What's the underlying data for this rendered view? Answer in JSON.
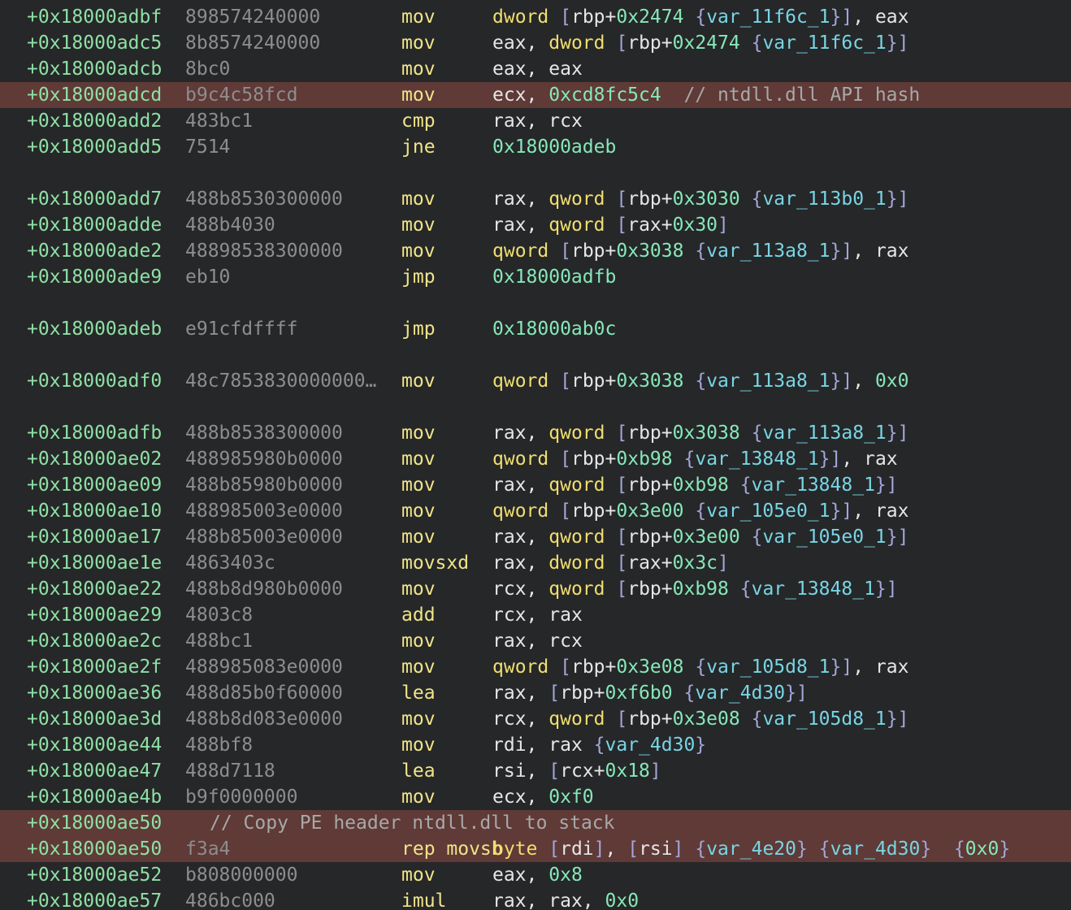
{
  "lines": [
    {
      "addr": "+0x18000adbf",
      "bytes": "898574240000",
      "mnem": "mov",
      "ops": [
        [
          "sz",
          "dword"
        ],
        [
          "pl",
          " "
        ],
        [
          "br",
          "["
        ],
        [
          "reg",
          "rbp"
        ],
        [
          "pl",
          "+"
        ],
        [
          "num",
          "0x2474"
        ],
        [
          "pl",
          " "
        ],
        [
          "br",
          "{"
        ],
        [
          "var",
          "var_11f6c_1"
        ],
        [
          "br",
          "}"
        ],
        [
          "br",
          "]"
        ],
        [
          "pl",
          ", "
        ],
        [
          "reg",
          "eax"
        ]
      ]
    },
    {
      "addr": "+0x18000adc5",
      "bytes": "8b8574240000",
      "mnem": "mov",
      "ops": [
        [
          "reg",
          "eax"
        ],
        [
          "pl",
          ", "
        ],
        [
          "sz",
          "dword"
        ],
        [
          "pl",
          " "
        ],
        [
          "br",
          "["
        ],
        [
          "reg",
          "rbp"
        ],
        [
          "pl",
          "+"
        ],
        [
          "num",
          "0x2474"
        ],
        [
          "pl",
          " "
        ],
        [
          "br",
          "{"
        ],
        [
          "var",
          "var_11f6c_1"
        ],
        [
          "br",
          "}"
        ],
        [
          "br",
          "]"
        ]
      ]
    },
    {
      "addr": "+0x18000adcb",
      "bytes": "8bc0",
      "mnem": "mov",
      "ops": [
        [
          "reg",
          "eax"
        ],
        [
          "pl",
          ", "
        ],
        [
          "reg",
          "eax"
        ]
      ]
    },
    {
      "addr": "+0x18000adcd",
      "bytes": "b9c4c58fcd",
      "mnem": "mov",
      "hl": true,
      "ops": [
        [
          "reg",
          "ecx"
        ],
        [
          "pl",
          ", "
        ],
        [
          "num",
          "0xcd8fc5c4"
        ],
        [
          "pl",
          "  "
        ],
        [
          "cmt",
          "// ntdll.dll API hash"
        ]
      ]
    },
    {
      "addr": "+0x18000add2",
      "bytes": "483bc1",
      "mnem": "cmp",
      "ops": [
        [
          "reg",
          "rax"
        ],
        [
          "pl",
          ", "
        ],
        [
          "reg",
          "rcx"
        ]
      ]
    },
    {
      "addr": "+0x18000add5",
      "bytes": "7514",
      "mnem": "jne",
      "ops": [
        [
          "num",
          "0x18000adeb"
        ]
      ]
    },
    {
      "blank": true
    },
    {
      "addr": "+0x18000add7",
      "bytes": "488b8530300000",
      "mnem": "mov",
      "ops": [
        [
          "reg",
          "rax"
        ],
        [
          "pl",
          ", "
        ],
        [
          "sz",
          "qword"
        ],
        [
          "pl",
          " "
        ],
        [
          "br",
          "["
        ],
        [
          "reg",
          "rbp"
        ],
        [
          "pl",
          "+"
        ],
        [
          "num",
          "0x3030"
        ],
        [
          "pl",
          " "
        ],
        [
          "br",
          "{"
        ],
        [
          "var",
          "var_113b0_1"
        ],
        [
          "br",
          "}"
        ],
        [
          "br",
          "]"
        ]
      ]
    },
    {
      "addr": "+0x18000adde",
      "bytes": "488b4030",
      "mnem": "mov",
      "ops": [
        [
          "reg",
          "rax"
        ],
        [
          "pl",
          ", "
        ],
        [
          "sz",
          "qword"
        ],
        [
          "pl",
          " "
        ],
        [
          "br",
          "["
        ],
        [
          "reg",
          "rax"
        ],
        [
          "pl",
          "+"
        ],
        [
          "num",
          "0x30"
        ],
        [
          "br",
          "]"
        ]
      ]
    },
    {
      "addr": "+0x18000ade2",
      "bytes": "48898538300000",
      "mnem": "mov",
      "ops": [
        [
          "sz",
          "qword"
        ],
        [
          "pl",
          " "
        ],
        [
          "br",
          "["
        ],
        [
          "reg",
          "rbp"
        ],
        [
          "pl",
          "+"
        ],
        [
          "num",
          "0x3038"
        ],
        [
          "pl",
          " "
        ],
        [
          "br",
          "{"
        ],
        [
          "var",
          "var_113a8_1"
        ],
        [
          "br",
          "}"
        ],
        [
          "br",
          "]"
        ],
        [
          "pl",
          ", "
        ],
        [
          "reg",
          "rax"
        ]
      ]
    },
    {
      "addr": "+0x18000ade9",
      "bytes": "eb10",
      "mnem": "jmp",
      "ops": [
        [
          "num",
          "0x18000adfb"
        ]
      ]
    },
    {
      "blank": true
    },
    {
      "addr": "+0x18000adeb",
      "bytes": "e91cfdffff",
      "mnem": "jmp",
      "ops": [
        [
          "num",
          "0x18000ab0c"
        ]
      ]
    },
    {
      "blank": true
    },
    {
      "addr": "+0x18000adf0",
      "bytes": "48c7853830000000…",
      "mnem": "mov",
      "ops": [
        [
          "sz",
          "qword"
        ],
        [
          "pl",
          " "
        ],
        [
          "br",
          "["
        ],
        [
          "reg",
          "rbp"
        ],
        [
          "pl",
          "+"
        ],
        [
          "num",
          "0x3038"
        ],
        [
          "pl",
          " "
        ],
        [
          "br",
          "{"
        ],
        [
          "var",
          "var_113a8_1"
        ],
        [
          "br",
          "}"
        ],
        [
          "br",
          "]"
        ],
        [
          "pl",
          ", "
        ],
        [
          "num",
          "0x0"
        ]
      ]
    },
    {
      "blank": true
    },
    {
      "addr": "+0x18000adfb",
      "bytes": "488b8538300000",
      "mnem": "mov",
      "ops": [
        [
          "reg",
          "rax"
        ],
        [
          "pl",
          ", "
        ],
        [
          "sz",
          "qword"
        ],
        [
          "pl",
          " "
        ],
        [
          "br",
          "["
        ],
        [
          "reg",
          "rbp"
        ],
        [
          "pl",
          "+"
        ],
        [
          "num",
          "0x3038"
        ],
        [
          "pl",
          " "
        ],
        [
          "br",
          "{"
        ],
        [
          "var",
          "var_113a8_1"
        ],
        [
          "br",
          "}"
        ],
        [
          "br",
          "]"
        ]
      ]
    },
    {
      "addr": "+0x18000ae02",
      "bytes": "488985980b0000",
      "mnem": "mov",
      "ops": [
        [
          "sz",
          "qword"
        ],
        [
          "pl",
          " "
        ],
        [
          "br",
          "["
        ],
        [
          "reg",
          "rbp"
        ],
        [
          "pl",
          "+"
        ],
        [
          "num",
          "0xb98"
        ],
        [
          "pl",
          " "
        ],
        [
          "br",
          "{"
        ],
        [
          "var",
          "var_13848_1"
        ],
        [
          "br",
          "}"
        ],
        [
          "br",
          "]"
        ],
        [
          "pl",
          ", "
        ],
        [
          "reg",
          "rax"
        ]
      ]
    },
    {
      "addr": "+0x18000ae09",
      "bytes": "488b85980b0000",
      "mnem": "mov",
      "ops": [
        [
          "reg",
          "rax"
        ],
        [
          "pl",
          ", "
        ],
        [
          "sz",
          "qword"
        ],
        [
          "pl",
          " "
        ],
        [
          "br",
          "["
        ],
        [
          "reg",
          "rbp"
        ],
        [
          "pl",
          "+"
        ],
        [
          "num",
          "0xb98"
        ],
        [
          "pl",
          " "
        ],
        [
          "br",
          "{"
        ],
        [
          "var",
          "var_13848_1"
        ],
        [
          "br",
          "}"
        ],
        [
          "br",
          "]"
        ]
      ]
    },
    {
      "addr": "+0x18000ae10",
      "bytes": "488985003e0000",
      "mnem": "mov",
      "ops": [
        [
          "sz",
          "qword"
        ],
        [
          "pl",
          " "
        ],
        [
          "br",
          "["
        ],
        [
          "reg",
          "rbp"
        ],
        [
          "pl",
          "+"
        ],
        [
          "num",
          "0x3e00"
        ],
        [
          "pl",
          " "
        ],
        [
          "br",
          "{"
        ],
        [
          "var",
          "var_105e0_1"
        ],
        [
          "br",
          "}"
        ],
        [
          "br",
          "]"
        ],
        [
          "pl",
          ", "
        ],
        [
          "reg",
          "rax"
        ]
      ]
    },
    {
      "addr": "+0x18000ae17",
      "bytes": "488b85003e0000",
      "mnem": "mov",
      "ops": [
        [
          "reg",
          "rax"
        ],
        [
          "pl",
          ", "
        ],
        [
          "sz",
          "qword"
        ],
        [
          "pl",
          " "
        ],
        [
          "br",
          "["
        ],
        [
          "reg",
          "rbp"
        ],
        [
          "pl",
          "+"
        ],
        [
          "num",
          "0x3e00"
        ],
        [
          "pl",
          " "
        ],
        [
          "br",
          "{"
        ],
        [
          "var",
          "var_105e0_1"
        ],
        [
          "br",
          "}"
        ],
        [
          "br",
          "]"
        ]
      ]
    },
    {
      "addr": "+0x18000ae1e",
      "bytes": "4863403c",
      "mnem": "movsxd",
      "ops": [
        [
          "reg",
          "rax"
        ],
        [
          "pl",
          ", "
        ],
        [
          "sz",
          "dword"
        ],
        [
          "pl",
          " "
        ],
        [
          "br",
          "["
        ],
        [
          "reg",
          "rax"
        ],
        [
          "pl",
          "+"
        ],
        [
          "num",
          "0x3c"
        ],
        [
          "br",
          "]"
        ]
      ]
    },
    {
      "addr": "+0x18000ae22",
      "bytes": "488b8d980b0000",
      "mnem": "mov",
      "ops": [
        [
          "reg",
          "rcx"
        ],
        [
          "pl",
          ", "
        ],
        [
          "sz",
          "qword"
        ],
        [
          "pl",
          " "
        ],
        [
          "br",
          "["
        ],
        [
          "reg",
          "rbp"
        ],
        [
          "pl",
          "+"
        ],
        [
          "num",
          "0xb98"
        ],
        [
          "pl",
          " "
        ],
        [
          "br",
          "{"
        ],
        [
          "var",
          "var_13848_1"
        ],
        [
          "br",
          "}"
        ],
        [
          "br",
          "]"
        ]
      ]
    },
    {
      "addr": "+0x18000ae29",
      "bytes": "4803c8",
      "mnem": "add",
      "ops": [
        [
          "reg",
          "rcx"
        ],
        [
          "pl",
          ", "
        ],
        [
          "reg",
          "rax"
        ]
      ]
    },
    {
      "addr": "+0x18000ae2c",
      "bytes": "488bc1",
      "mnem": "mov",
      "ops": [
        [
          "reg",
          "rax"
        ],
        [
          "pl",
          ", "
        ],
        [
          "reg",
          "rcx"
        ]
      ]
    },
    {
      "addr": "+0x18000ae2f",
      "bytes": "488985083e0000",
      "mnem": "mov",
      "ops": [
        [
          "sz",
          "qword"
        ],
        [
          "pl",
          " "
        ],
        [
          "br",
          "["
        ],
        [
          "reg",
          "rbp"
        ],
        [
          "pl",
          "+"
        ],
        [
          "num",
          "0x3e08"
        ],
        [
          "pl",
          " "
        ],
        [
          "br",
          "{"
        ],
        [
          "var",
          "var_105d8_1"
        ],
        [
          "br",
          "}"
        ],
        [
          "br",
          "]"
        ],
        [
          "pl",
          ", "
        ],
        [
          "reg",
          "rax"
        ]
      ]
    },
    {
      "addr": "+0x18000ae36",
      "bytes": "488d85b0f60000",
      "mnem": "lea",
      "ops": [
        [
          "reg",
          "rax"
        ],
        [
          "pl",
          ", "
        ],
        [
          "br",
          "["
        ],
        [
          "reg",
          "rbp"
        ],
        [
          "pl",
          "+"
        ],
        [
          "num",
          "0xf6b0"
        ],
        [
          "pl",
          " "
        ],
        [
          "br",
          "{"
        ],
        [
          "var",
          "var_4d30"
        ],
        [
          "br",
          "}"
        ],
        [
          "br",
          "]"
        ]
      ]
    },
    {
      "addr": "+0x18000ae3d",
      "bytes": "488b8d083e0000",
      "mnem": "mov",
      "ops": [
        [
          "reg",
          "rcx"
        ],
        [
          "pl",
          ", "
        ],
        [
          "sz",
          "qword"
        ],
        [
          "pl",
          " "
        ],
        [
          "br",
          "["
        ],
        [
          "reg",
          "rbp"
        ],
        [
          "pl",
          "+"
        ],
        [
          "num",
          "0x3e08"
        ],
        [
          "pl",
          " "
        ],
        [
          "br",
          "{"
        ],
        [
          "var",
          "var_105d8_1"
        ],
        [
          "br",
          "}"
        ],
        [
          "br",
          "]"
        ]
      ]
    },
    {
      "addr": "+0x18000ae44",
      "bytes": "488bf8",
      "mnem": "mov",
      "ops": [
        [
          "reg",
          "rdi"
        ],
        [
          "pl",
          ", "
        ],
        [
          "reg",
          "rax"
        ],
        [
          "pl",
          " "
        ],
        [
          "br",
          "{"
        ],
        [
          "var",
          "var_4d30"
        ],
        [
          "br",
          "}"
        ]
      ]
    },
    {
      "addr": "+0x18000ae47",
      "bytes": "488d7118",
      "mnem": "lea",
      "ops": [
        [
          "reg",
          "rsi"
        ],
        [
          "pl",
          ", "
        ],
        [
          "br",
          "["
        ],
        [
          "reg",
          "rcx"
        ],
        [
          "pl",
          "+"
        ],
        [
          "num",
          "0x18"
        ],
        [
          "br",
          "]"
        ]
      ]
    },
    {
      "addr": "+0x18000ae4b",
      "bytes": "b9f0000000",
      "mnem": "mov",
      "ops": [
        [
          "reg",
          "ecx"
        ],
        [
          "pl",
          ", "
        ],
        [
          "num",
          "0xf0"
        ]
      ]
    },
    {
      "addr": "+0x18000ae50",
      "comment": "// Copy PE header ntdll.dll to stack",
      "hl": true
    },
    {
      "addr": "+0x18000ae50",
      "bytes": "f3a4",
      "mnem": "rep movsb",
      "hl": true,
      "ops": [
        [
          "sz",
          "byte"
        ],
        [
          "pl",
          " "
        ],
        [
          "br",
          "["
        ],
        [
          "reg",
          "rdi"
        ],
        [
          "br",
          "]"
        ],
        [
          "pl",
          ", "
        ],
        [
          "br",
          "["
        ],
        [
          "reg",
          "rsi"
        ],
        [
          "br",
          "]"
        ],
        [
          "pl",
          " "
        ],
        [
          "br",
          "{"
        ],
        [
          "var",
          "var_4e20"
        ],
        [
          "br",
          "}"
        ],
        [
          "pl",
          " "
        ],
        [
          "br",
          "{"
        ],
        [
          "var",
          "var_4d30"
        ],
        [
          "br",
          "}"
        ],
        [
          "pl",
          "  "
        ],
        [
          "br",
          "{"
        ],
        [
          "num",
          "0x0"
        ],
        [
          "br",
          "}"
        ]
      ]
    },
    {
      "addr": "+0x18000ae52",
      "bytes": "b808000000",
      "mnem": "mov",
      "ops": [
        [
          "reg",
          "eax"
        ],
        [
          "pl",
          ", "
        ],
        [
          "num",
          "0x8"
        ]
      ]
    },
    {
      "addr": "+0x18000ae57",
      "bytes": "486bc000",
      "mnem": "imul",
      "ops": [
        [
          "reg",
          "rax"
        ],
        [
          "pl",
          ", "
        ],
        [
          "reg",
          "rax"
        ],
        [
          "pl",
          ", "
        ],
        [
          "num",
          "0x0"
        ]
      ]
    }
  ]
}
